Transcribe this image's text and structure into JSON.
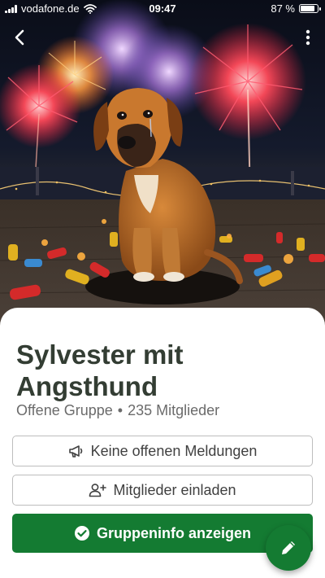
{
  "status_bar": {
    "carrier": "vodafone.de",
    "time": "09:47",
    "battery_text": "87 %",
    "battery_level": 0.87
  },
  "nav": {
    "back_icon": "chevron-left-icon",
    "more_icon": "vertical-dots-icon"
  },
  "hero": {
    "image": "sad dog sitting among exploded firecrackers with fireworks in the night sky"
  },
  "group": {
    "title": "Sylvester mit Angsthund",
    "type": "Offene Gruppe",
    "separator": "•",
    "members": "235 Mitglieder"
  },
  "actions": {
    "reports_label": "Keine offenen Meldungen",
    "reports_icon": "megaphone-icon",
    "invite_label": "Mitglieder einladen",
    "invite_icon": "add-user-icon",
    "info_label": "Gruppeninfo anzeigen",
    "info_icon": "check-circle-icon",
    "fab_icon": "pencil-icon"
  },
  "colors": {
    "primary": "#147b32",
    "title": "#333d33",
    "meta": "#6b6b6b"
  }
}
